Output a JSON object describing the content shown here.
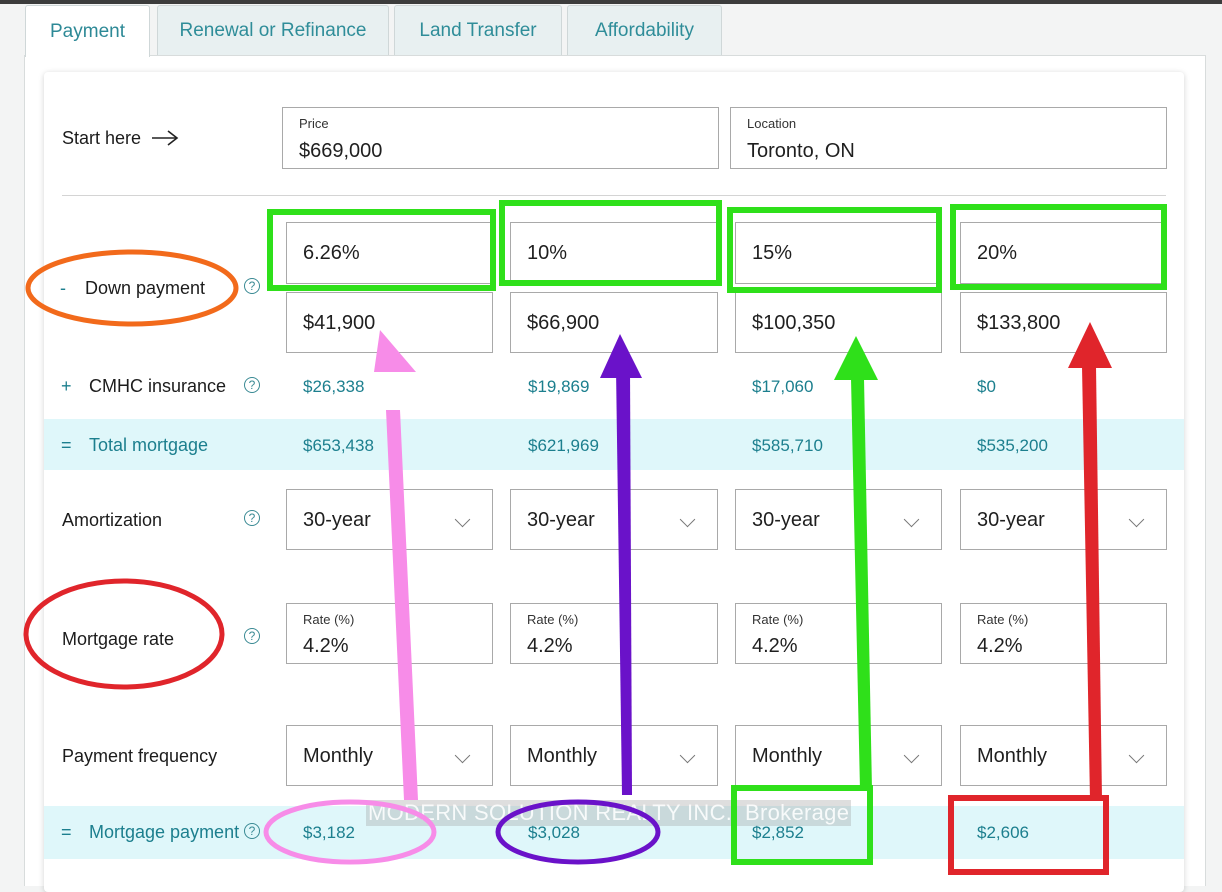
{
  "tabs": [
    {
      "label": "Payment",
      "active": true
    },
    {
      "label": "Renewal or Refinance",
      "active": false
    },
    {
      "label": "Land Transfer",
      "active": false
    },
    {
      "label": "Affordability",
      "active": false
    }
  ],
  "start": {
    "label": "Start here",
    "price_label": "Price",
    "price_value": "$669,000",
    "location_label": "Location",
    "location_value": "Toronto, ON"
  },
  "rows": {
    "down_payment": {
      "sign": "-",
      "label": "Down payment"
    },
    "cmhc": {
      "sign": "+",
      "label": "CMHC insurance"
    },
    "total": {
      "sign": "=",
      "label": "Total mortgage"
    },
    "amortization": {
      "label": "Amortization"
    },
    "rate": {
      "label": "Mortgage rate"
    },
    "frequency": {
      "label": "Payment frequency"
    },
    "payment": {
      "sign": "=",
      "label": "Mortgage payment"
    }
  },
  "help_glyph": "?",
  "columns": [
    {
      "down_pct": "6.26%",
      "down_amt": "$41,900",
      "cmhc": "$26,338",
      "total": "$653,438",
      "amortization": "30-year",
      "rate_label": "Rate (%)",
      "rate": "4.2%",
      "frequency": "Monthly",
      "payment": "$3,182"
    },
    {
      "down_pct": "10%",
      "down_amt": "$66,900",
      "cmhc": "$19,869",
      "total": "$621,969",
      "amortization": "30-year",
      "rate_label": "Rate (%)",
      "rate": "4.2%",
      "frequency": "Monthly",
      "payment": "$3,028"
    },
    {
      "down_pct": "15%",
      "down_amt": "$100,350",
      "cmhc": "$17,060",
      "total": "$585,710",
      "amortization": "30-year",
      "rate_label": "Rate (%)",
      "rate": "4.2%",
      "frequency": "Monthly",
      "payment": "$2,852"
    },
    {
      "down_pct": "20%",
      "down_amt": "$133,800",
      "cmhc": "$0",
      "total": "$535,200",
      "amortization": "30-year",
      "rate_label": "Rate (%)",
      "rate": "4.2%",
      "frequency": "Monthly",
      "payment": "$2,606"
    }
  ],
  "watermark": "MODERN SOLUTION REALTY INC., Brokerage",
  "annotation_colors": {
    "orange": "#f26a1b",
    "red": "#e0252b",
    "green": "#2fe01a",
    "pink": "#f78ce8",
    "purple": "#6a12c9",
    "teal": "#1c7f8e",
    "band": "#dff7fa"
  }
}
